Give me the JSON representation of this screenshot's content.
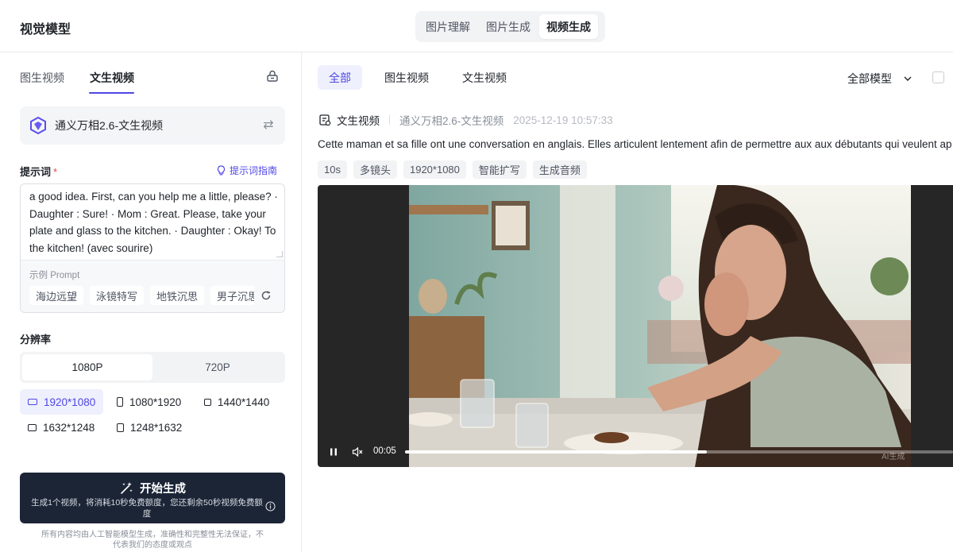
{
  "header": {
    "title": "视觉模型",
    "tabs": [
      {
        "label": "图片理解"
      },
      {
        "label": "图片生成"
      },
      {
        "label": "视频生成"
      }
    ]
  },
  "left_panel": {
    "tabs": [
      {
        "label": "图生视频"
      },
      {
        "label": "文生视频"
      }
    ],
    "model": {
      "name": "通义万相2.6-文生视频",
      "logo_icon": "tongyi-logo-icon",
      "switch_icon": "swap-icon"
    },
    "prompt": {
      "label": "提示词",
      "required_mark": "*",
      "guide_label": "提示词指南",
      "text": "a good idea. First, can you help me a little, please? · Daughter : Sure! · Mom : Great. Please, take your plate and glass to the kitchen. · Daughter : Okay! To the kitchen! (avec sourire)",
      "examples_title": "示例 Prompt",
      "examples": [
        "海边远望",
        "泳镜特写",
        "地铁沉思",
        "男子沉思"
      ]
    },
    "resolution": {
      "label": "分辨率",
      "options": [
        "1080P",
        "720P"
      ],
      "selected": "1080P",
      "ratios": [
        "1920*1080",
        "1080*1920",
        "1440*1440",
        "1632*1248",
        "1248*1632"
      ],
      "selected_ratio": "1920*1080"
    },
    "generate": {
      "label": "开始生成",
      "sub": "生成1个视频，将消耗10秒免费额度，您还剩余50秒视频免费额度"
    },
    "disclaimer": "所有内容均由人工智能模型生成，准确性和完整性无法保证，不代表我们的态度或观点"
  },
  "right_panel": {
    "filters": [
      "全部",
      "图生视频",
      "文生视频"
    ],
    "active_filter": "全部",
    "model_filter": "全部模型",
    "item": {
      "type": "文生视频",
      "model": "通义万相2.6-文生视频",
      "timestamp": "2025-12-19 10:57:33",
      "description": "Cette maman et sa fille ont une conversation en anglais. Elles articulent lentement afin de permettre aux aux débutants qui veulent ap",
      "tags": [
        "10s",
        "多镜头",
        "1920*1080",
        "智能扩写",
        "生成音频"
      ],
      "video": {
        "current_time": "00:05",
        "progress": 0.55,
        "watermark": "AI生成"
      }
    }
  },
  "colors": {
    "accent": "#4f46e5",
    "accent_bg": "#eef0fd",
    "button_dark": "#1b2536"
  }
}
